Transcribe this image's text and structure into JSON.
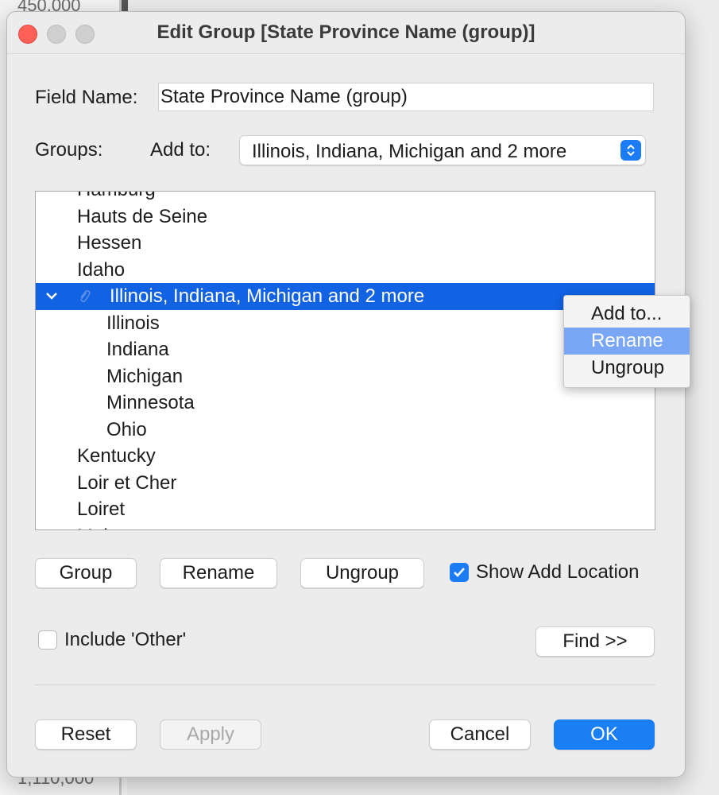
{
  "background": {
    "axis_top": "450,000",
    "axis_bottom": "1,110,000"
  },
  "dialog": {
    "title": "Edit Group [State Province Name (group)]",
    "field_name_label": "Field Name:",
    "field_name_value": "State Province Name (group)",
    "groups_label": "Groups:",
    "add_to_label": "Add to:",
    "add_to_selected": "Illinois, Indiana, Michigan and 2 more",
    "list": [
      {
        "label": "Hamburg",
        "level": 0
      },
      {
        "label": "Hauts de Seine",
        "level": 0
      },
      {
        "label": "Hessen",
        "level": 0
      },
      {
        "label": "Idaho",
        "level": 0
      },
      {
        "label": "Illinois, Indiana, Michigan and 2 more",
        "level": 0,
        "group": true,
        "selected": true
      },
      {
        "label": "Illinois",
        "level": 1
      },
      {
        "label": "Indiana",
        "level": 1
      },
      {
        "label": "Michigan",
        "level": 1
      },
      {
        "label": "Minnesota",
        "level": 1
      },
      {
        "label": "Ohio",
        "level": 1
      },
      {
        "label": "Kentucky",
        "level": 0
      },
      {
        "label": "Loir et Cher",
        "level": 0
      },
      {
        "label": "Loiret",
        "level": 0
      },
      {
        "label": "Maine",
        "level": 0
      }
    ],
    "context_menu": {
      "items": [
        "Add to...",
        "Rename",
        "Ungroup"
      ],
      "highlighted": "Rename"
    },
    "buttons": {
      "group": "Group",
      "rename": "Rename",
      "ungroup": "Ungroup",
      "find": "Find >>",
      "reset": "Reset",
      "apply": "Apply",
      "cancel": "Cancel",
      "ok": "OK"
    },
    "show_add_location": {
      "label": "Show Add Location",
      "checked": true
    },
    "include_other": {
      "label": "Include 'Other'",
      "checked": false
    },
    "colors": {
      "accent": "#1a7ff5",
      "selection": "#1262e4",
      "menu_highlight": "#7aa7f5"
    }
  }
}
